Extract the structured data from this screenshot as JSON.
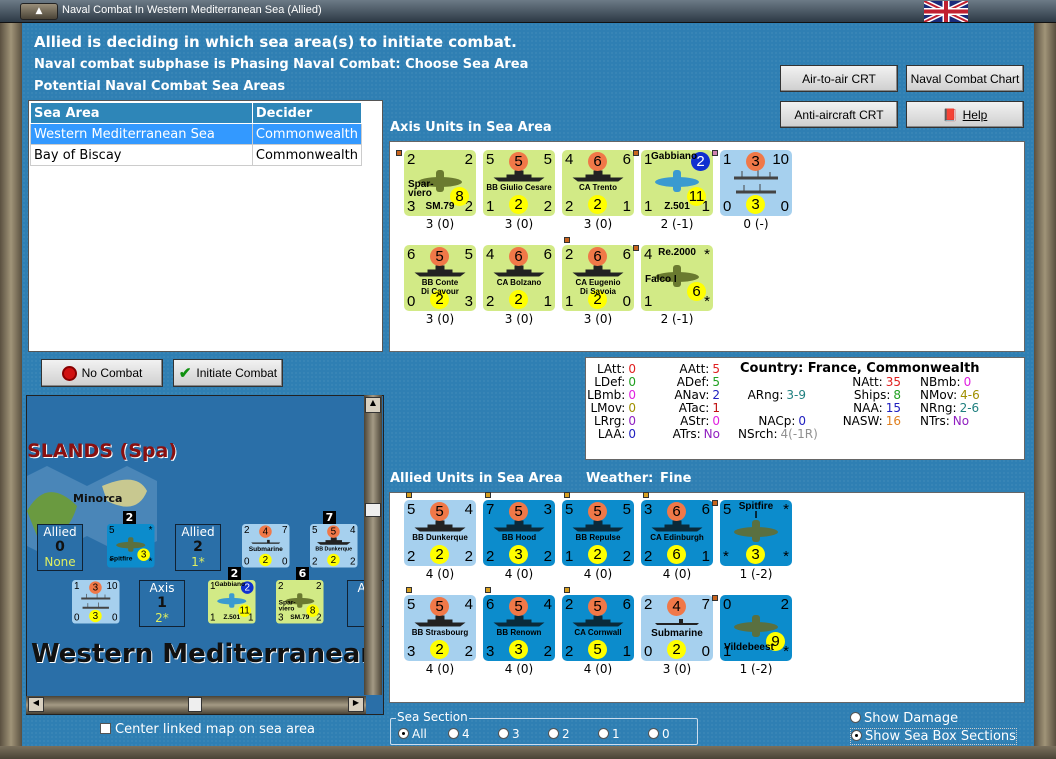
{
  "window": {
    "title": "Naval Combat In Western Mediterranean Sea (Allied)"
  },
  "header": {
    "line1": "Allied is deciding in which sea area(s) to initiate combat.",
    "line2": "Naval combat subphase is Phasing Naval Combat: Choose Sea Area",
    "line3": "Potential Naval Combat Sea Areas"
  },
  "sea_table": {
    "columns": [
      "Sea Area",
      "Decider"
    ],
    "rows": [
      [
        "Western Mediterranean Sea",
        "Commonwealth"
      ],
      [
        "Bay of Biscay",
        "Commonwealth"
      ]
    ]
  },
  "buttons": {
    "air_to_air": "Air-to-air CRT",
    "naval_chart": "Naval Combat Chart",
    "anti_aircraft": "Anti-aircraft CRT",
    "help": "Help",
    "no_combat": "No Combat",
    "initiate": "Initiate Combat"
  },
  "axis": {
    "label": "Axis Units in Sea Area",
    "units": [
      {
        "name": "Spar-\nviero",
        "model": "SM.79",
        "tl": "2",
        "tr": "2",
        "bl": "3",
        "bc": "8",
        "br": "2",
        "foot": "3 (0)",
        "color": "g",
        "dot": "#c8641e",
        "type": "plane"
      },
      {
        "name": "BB Giulio Cesare",
        "tl": "5",
        "tc": "5",
        "tr": "5",
        "bl": "1",
        "bc": "2",
        "br": "2",
        "foot": "3 (0)",
        "color": "g",
        "type": "ship"
      },
      {
        "name": "CA Trento",
        "tl": "4",
        "tc": "6",
        "tr": "6",
        "bl": "2",
        "bc": "2",
        "br": "1",
        "foot": "3 (0)",
        "color": "g",
        "type": "ship"
      },
      {
        "name": "Gabbiano",
        "model": "Z.501",
        "tl": "1",
        "tc": "2",
        "tr": "",
        "bl": "1",
        "bc": "11",
        "br": "1",
        "foot": "2 (-1)",
        "color": "g",
        "dot": "#c8641e",
        "type": "plane",
        "blue": true
      },
      {
        "name": "",
        "tl": "1",
        "tc": "3",
        "tr": "10",
        "bl": "0",
        "bc": "3",
        "br": "0",
        "foot": "0 (-)",
        "color": "lb",
        "dot": "#d080b0",
        "type": "convoy"
      },
      {
        "name": "BB Conte\nDi Cavour",
        "tl": "6",
        "tc": "5",
        "tr": "5",
        "bl": "0",
        "bc": "2",
        "br": "3",
        "foot": "3 (0)",
        "color": "g",
        "type": "ship"
      },
      {
        "name": "CA Bolzano",
        "tl": "4",
        "tc": "6",
        "tr": "6",
        "bl": "2",
        "bc": "2",
        "br": "1",
        "foot": "3 (0)",
        "color": "g",
        "type": "ship"
      },
      {
        "name": "CA Eugenio\nDi Savoia",
        "tl": "2",
        "tc": "6",
        "tr": "6",
        "bl": "1",
        "bc": "2",
        "br": "0",
        "foot": "3 (0)",
        "color": "g",
        "dot": "#c8641e",
        "type": "ship"
      },
      {
        "name": "Falco I",
        "model": "Re.2000",
        "tl": "4",
        "tr": "*",
        "bl": "1",
        "bc": "6",
        "br": "*",
        "foot": "2 (-1)",
        "color": "g",
        "dot": "#c8641e",
        "type": "plane"
      }
    ]
  },
  "allied": {
    "label": "Allied Units in Sea Area",
    "weather_label": "Weather:",
    "weather": "Fine",
    "units": [
      {
        "name": "BB Dunkerque",
        "tl": "5",
        "tc": "5",
        "tr": "4",
        "bl": "2",
        "bc": "2",
        "br": "2",
        "foot": "4 (0)",
        "color": "lb",
        "dot": "#d8a020",
        "type": "ship"
      },
      {
        "name": "BB Hood",
        "tl": "7",
        "tc": "5",
        "tr": "3",
        "bl": "2",
        "bc": "3",
        "br": "2",
        "foot": "4 (0)",
        "color": "db",
        "dot": "#d8a020",
        "type": "ship"
      },
      {
        "name": "BB Repulse",
        "tl": "5",
        "tc": "5",
        "tr": "5",
        "bl": "1",
        "bc": "2",
        "br": "2",
        "foot": "4 (0)",
        "color": "db",
        "dot": "#d8a020",
        "type": "ship"
      },
      {
        "name": "CA Edinburgh",
        "tl": "3",
        "tc": "6",
        "tr": "6",
        "bl": "2",
        "bc": "6",
        "br": "1",
        "foot": "4 (0)",
        "color": "db",
        "dot": "#d8a020",
        "type": "ship"
      },
      {
        "name": "Spitfire\nI",
        "tl": "5",
        "tr": "*",
        "bl": "*",
        "bc": "3",
        "br": "*",
        "foot": "1 (-2)",
        "color": "db",
        "dot": "#c8641e",
        "type": "plane",
        "top": true
      },
      {
        "name": "BB Strasbourg",
        "tl": "5",
        "tc": "5",
        "tr": "4",
        "bl": "3",
        "bc": "2",
        "br": "2",
        "foot": "4 (0)",
        "color": "lb",
        "dot": "#d8a020",
        "type": "ship"
      },
      {
        "name": "BB Renown",
        "tl": "6",
        "tc": "5",
        "tr": "4",
        "bl": "3",
        "bc": "3",
        "br": "2",
        "foot": "4 (0)",
        "color": "db",
        "dot": "#d8a020",
        "type": "ship"
      },
      {
        "name": "CA Cornwall",
        "tl": "2",
        "tc": "5",
        "tr": "6",
        "bl": "2",
        "bc": "5",
        "br": "1",
        "foot": "4 (0)",
        "color": "db",
        "dot": "#d8a020",
        "type": "ship"
      },
      {
        "name": "Submarine",
        "tl": "2",
        "tc": "4",
        "tr": "7",
        "bl": "0",
        "bc": "2",
        "br": "0",
        "foot": "3 (0)",
        "color": "lb",
        "type": "sub"
      },
      {
        "name": "Vildebeest",
        "tl": "0",
        "tr": "2",
        "bl": "1",
        "bc": "9",
        "br": "*",
        "foot": "1 (-2)",
        "color": "db",
        "dot": "#c8641e",
        "type": "plane"
      }
    ]
  },
  "stats": {
    "country": "Country: France, Commonwealth",
    "items": [
      [
        "LAtt:",
        "0",
        "#e02020"
      ],
      [
        "LDef:",
        "0",
        "#20a020"
      ],
      [
        "LBmb:",
        "0",
        "#e020e0"
      ],
      [
        "LMov:",
        "0",
        "#a09000"
      ],
      [
        "LRrg:",
        "0",
        "#9020c0"
      ],
      [
        "LAA:",
        "0",
        "#2020c0"
      ],
      [
        "AAtt:",
        "5",
        "#e02020"
      ],
      [
        "ADef:",
        "5",
        "#20a020"
      ],
      [
        "ANav:",
        "2",
        "#2020c0"
      ],
      [
        "ATac:",
        "1",
        "#c01010"
      ],
      [
        "AStr:",
        "0",
        "#e020e0"
      ],
      [
        "ATrs:",
        "No",
        "#9020c0"
      ],
      [
        "ARng:",
        "3-9",
        "#208080"
      ],
      [
        "NACp:",
        "0",
        "#2020c0"
      ],
      [
        "NSrch:",
        "4(-1R)",
        "#909090"
      ],
      [
        "NAtt:",
        "35",
        "#e02020"
      ],
      [
        "Ships:",
        "8",
        "#20a020"
      ],
      [
        "NAA:",
        "15",
        "#2020c0"
      ],
      [
        "NASW:",
        "16",
        "#e08020"
      ],
      [
        "NBmb:",
        "0",
        "#e020e0"
      ],
      [
        "NMov:",
        "4-6",
        "#a09000"
      ],
      [
        "NRng:",
        "2-6",
        "#208080"
      ],
      [
        "NTrs:",
        "No",
        "#9020c0"
      ]
    ]
  },
  "map": {
    "region": "ISLANDS (Spa)",
    "island": "Minorca",
    "sea": "Western Mediterranean",
    "boxes": [
      {
        "side": "Allied",
        "num": "0",
        "sub": "None"
      },
      {
        "side": "Allied",
        "num": "2",
        "sub": "1*"
      },
      {
        "side": "Axis",
        "num": "1",
        "sub": "2*"
      },
      {
        "side": "Axis",
        "num": "",
        "sub": ""
      }
    ],
    "stacks": [
      "2",
      "7",
      "2",
      "6"
    ],
    "counters": [
      {
        "name": "Spitfire",
        "tl": "5",
        "tr": "*",
        "bl": "*",
        "bc": "3",
        "br": "*",
        "color": "db",
        "type": "plane"
      },
      {
        "name": "Submarine",
        "tl": "2",
        "tc": "4",
        "tr": "7",
        "bl": "0",
        "bc": "2",
        "br": "0",
        "color": "lb",
        "type": "sub"
      },
      {
        "name": "BB Dunkerque",
        "tl": "5",
        "tc": "5",
        "tr": "4",
        "bl": "2",
        "bc": "2",
        "br": "2",
        "color": "lb",
        "type": "ship"
      },
      {
        "name": "",
        "tl": "1",
        "tc": "3",
        "tr": "10",
        "bl": "0",
        "bc": "3",
        "br": "0",
        "color": "lb",
        "type": "convoy"
      },
      {
        "name": "Gabbiano",
        "model": "Z.501",
        "tl": "1",
        "tc": "2",
        "tr": "",
        "bl": "1",
        "bc": "11",
        "br": "1",
        "color": "g",
        "type": "plane",
        "blue": true
      },
      {
        "name": "Spar-\nviero",
        "model": "SM.79",
        "tl": "2",
        "tr": "2",
        "bl": "3",
        "bc": "8",
        "br": "2",
        "color": "g",
        "type": "plane"
      }
    ]
  },
  "options": {
    "center_linked": "Center linked map on sea area",
    "sea_section": "Sea Section",
    "sections": [
      "All",
      "4",
      "3",
      "2",
      "1",
      "0"
    ],
    "show_damage": "Show Damage",
    "show_boxes": "Show Sea Box Sections"
  }
}
